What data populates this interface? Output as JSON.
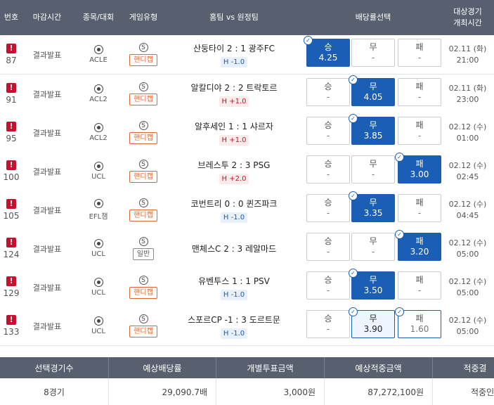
{
  "header": {
    "number": "번호",
    "deadline": "마감시간",
    "sport": "종목/대회",
    "game_type": "게임유형",
    "match": "홈팀 vs 원정팀",
    "odds": "배당률선택",
    "date_line1": "대상경기",
    "date_line2": "개최시간"
  },
  "rows": [
    {
      "number": "87",
      "status": "결과발표",
      "league": "ACLE",
      "type_icon": "S",
      "type": "핸디캡",
      "teams": "산둥타이 2 : 1 광주FC",
      "handicap": "H -1.0",
      "odds": [
        {
          "label": "승",
          "value": "4.25"
        },
        {
          "label": "무",
          "value": "-"
        },
        {
          "label": "패",
          "value": "-"
        }
      ],
      "date": "02.11 (화)",
      "time": "21:00"
    },
    {
      "number": "91",
      "status": "결과발표",
      "league": "ACL2",
      "type_icon": "S",
      "type": "핸디캡",
      "teams": "알칼디야 2 : 2 트락토르",
      "handicap": "H +1.0",
      "odds": [
        {
          "label": "승",
          "value": "-"
        },
        {
          "label": "무",
          "value": "4.05"
        },
        {
          "label": "패",
          "value": "-"
        }
      ],
      "date": "02.11 (화)",
      "time": "23:00"
    },
    {
      "number": "95",
      "status": "결과발표",
      "league": "ACL2",
      "type_icon": "S",
      "type": "핸디캡",
      "teams": "알후세인 1 : 1 샤르자",
      "handicap": "H +1.0",
      "odds": [
        {
          "label": "승",
          "value": "-"
        },
        {
          "label": "무",
          "value": "3.85"
        },
        {
          "label": "패",
          "value": "-"
        }
      ],
      "date": "02.12 (수)",
      "time": "01:00"
    },
    {
      "number": "100",
      "status": "결과발표",
      "league": "UCL",
      "type_icon": "S",
      "type": "핸디캡",
      "teams": "브레스투 2 : 3 PSG",
      "handicap": "H +2.0",
      "odds": [
        {
          "label": "승",
          "value": "-"
        },
        {
          "label": "무",
          "value": "-"
        },
        {
          "label": "패",
          "value": "3.00"
        }
      ],
      "date": "02.12 (수)",
      "time": "02:45"
    },
    {
      "number": "105",
      "status": "결과발표",
      "league": "EFL챔",
      "type_icon": "S",
      "type": "핸디캡",
      "teams": "코번트리 0 : 0 퀸즈파크",
      "handicap": "H -1.0",
      "odds": [
        {
          "label": "승",
          "value": "-"
        },
        {
          "label": "무",
          "value": "3.35"
        },
        {
          "label": "패",
          "value": "-"
        }
      ],
      "date": "02.12 (수)",
      "time": "04:45"
    },
    {
      "number": "124",
      "status": "결과발표",
      "league": "UCL",
      "type_icon": "S",
      "type": "일반",
      "teams": "맨체스C 2 : 3 레알마드",
      "handicap": "",
      "odds": [
        {
          "label": "승",
          "value": "-"
        },
        {
          "label": "무",
          "value": "-"
        },
        {
          "label": "패",
          "value": "3.20"
        }
      ],
      "date": "02.12 (수)",
      "time": "05:00"
    },
    {
      "number": "129",
      "status": "결과발표",
      "league": "UCL",
      "type_icon": "S",
      "type": "핸디캡",
      "teams": "유벤투스 1 : 1 PSV",
      "handicap": "H -1.0",
      "odds": [
        {
          "label": "승",
          "value": "-"
        },
        {
          "label": "무",
          "value": "3.50"
        },
        {
          "label": "패",
          "value": "-"
        }
      ],
      "date": "02.12 (수)",
      "time": "05:00"
    },
    {
      "number": "133",
      "status": "결과발표",
      "league": "UCL",
      "type_icon": "S",
      "type": "핸디캡",
      "teams": "스포르CP -1 : 3 도르트문",
      "handicap": "H -1.0",
      "odds": [
        {
          "label": "승",
          "value": "-"
        },
        {
          "label": "무",
          "value": "3.90"
        },
        {
          "label": "패",
          "value": "1.60"
        }
      ],
      "date": "02.12 (수)",
      "time": "05:00"
    }
  ],
  "summary": {
    "headers": [
      "선택경기수",
      "예상배당률",
      "개별투표금액",
      "예상적중금액",
      "적중결"
    ],
    "values": [
      "8경기",
      "29,090.7배",
      "3,000원",
      "87,272,100원",
      "적중인"
    ]
  },
  "colors": {
    "header_bg": "#58606f",
    "selected": "#1a5eb5",
    "warning": "#c8102e",
    "handicap_badge": "#e0662f"
  }
}
